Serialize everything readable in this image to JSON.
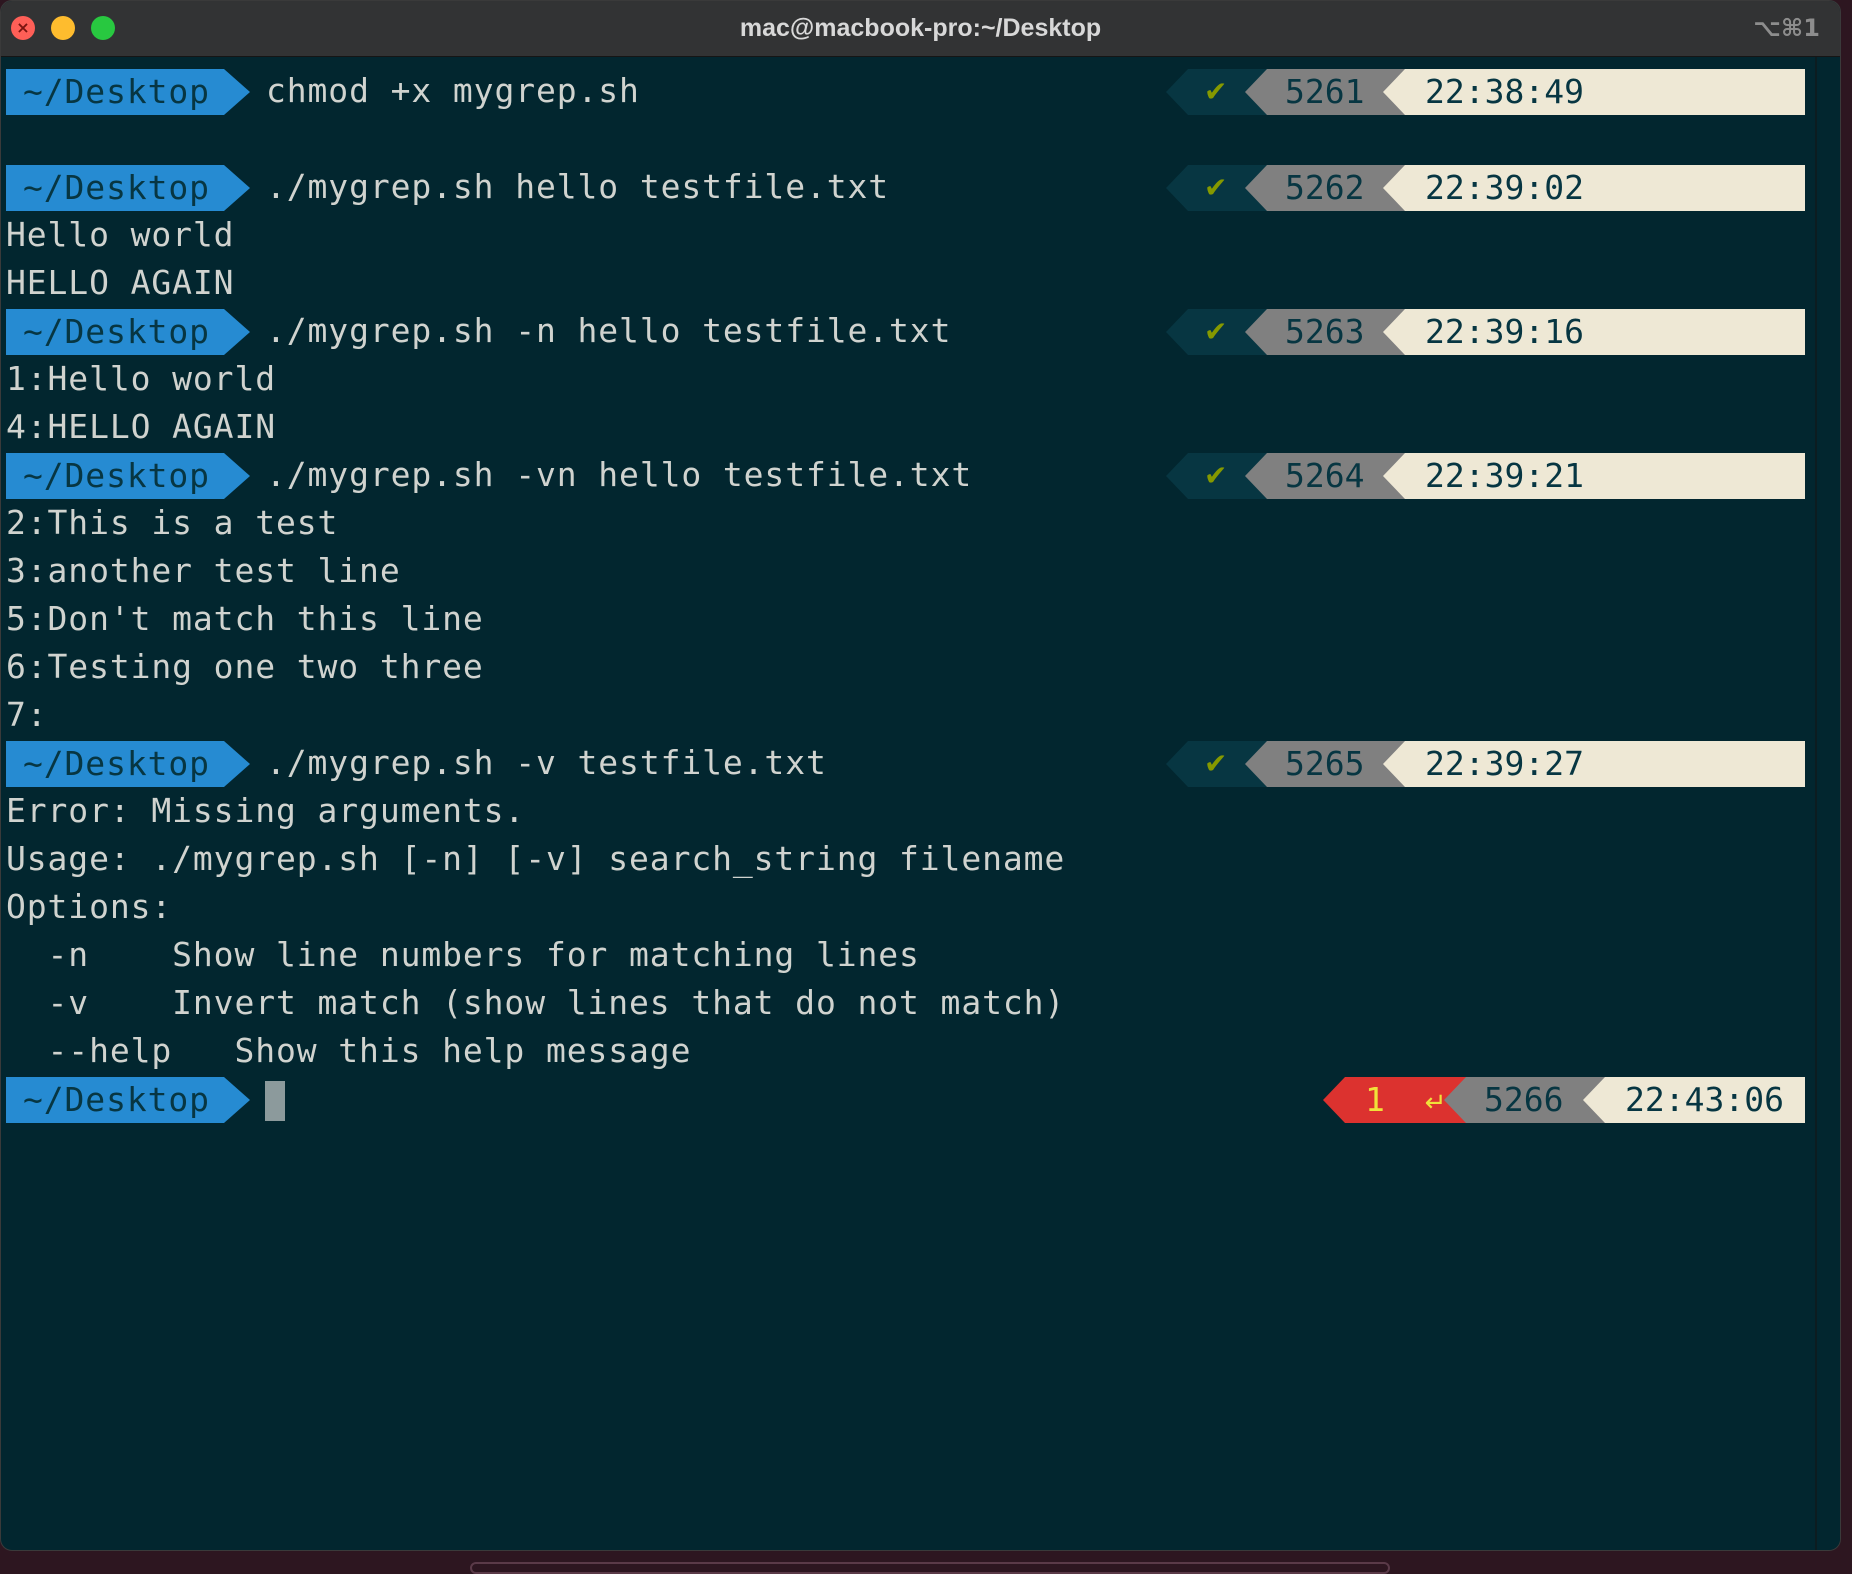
{
  "window": {
    "title": "mac@macbook-pro:~/Desktop",
    "shortcut": "⌥⌘1"
  },
  "prompt_dir": "~/Desktop",
  "status_ok_symbol": "✔",
  "commands": [
    {
      "cmd": "chmod +x mygrep.sh",
      "status": "✔",
      "num": "5261",
      "time": "22:38:49"
    },
    {
      "cmd": "./mygrep.sh hello testfile.txt",
      "status": "✔",
      "num": "5262",
      "time": "22:39:02"
    },
    {
      "cmd": "./mygrep.sh -n hello testfile.txt",
      "status": "✔",
      "num": "5263",
      "time": "22:39:16"
    },
    {
      "cmd": "./mygrep.sh -vn hello testfile.txt",
      "status": "✔",
      "num": "5264",
      "time": "22:39:21"
    },
    {
      "cmd": "./mygrep.sh -v testfile.txt",
      "status": "✔",
      "num": "5265",
      "time": "22:39:27"
    }
  ],
  "outputs": {
    "cmd2": [
      "Hello world",
      "HELLO AGAIN"
    ],
    "cmd3": [
      "1:Hello world",
      "4:HELLO AGAIN"
    ],
    "cmd4": [
      "2:This is a test",
      "3:another test line",
      "5:Don't match this line",
      "6:Testing one two three",
      "7:"
    ],
    "cmd5": [
      "Error: Missing arguments.",
      "Usage: ./mygrep.sh [-n] [-v] search_string filename",
      "Options:",
      "  -n    Show line numbers for matching lines",
      "  -v    Invert match (show lines that do not match)",
      "  --help   Show this help message"
    ]
  },
  "current_prompt": {
    "exit_code": "1",
    "return_symbol": "↵",
    "num": "5266",
    "time": "22:43:06"
  },
  "colors": {
    "background": "#02262f",
    "dir_segment": "#268bd2",
    "ok_check": "#859900",
    "error_segment": "#dc322f",
    "time_segment": "#eee8d5",
    "num_segment": "#808080"
  }
}
